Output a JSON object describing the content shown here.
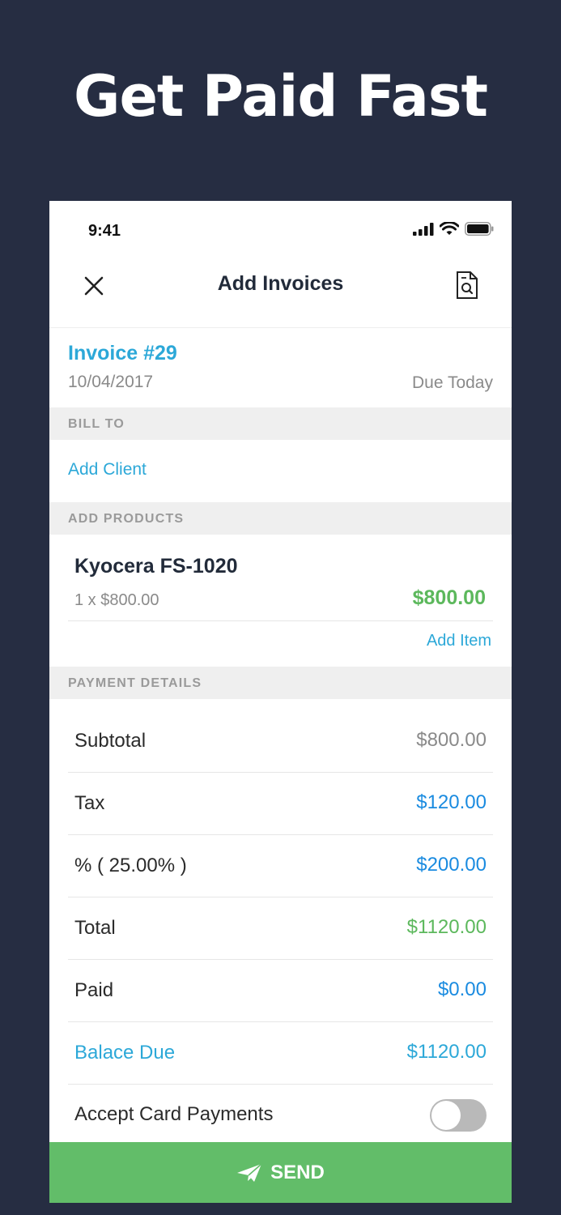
{
  "headline": "Get Paid Fast",
  "status_bar": {
    "time": "9:41"
  },
  "nav": {
    "title": "Add Invoices"
  },
  "invoice": {
    "number": "Invoice #29",
    "date": "10/04/2017",
    "due": "Due Today"
  },
  "bill_to": {
    "header": "BILL TO",
    "add_client": "Add Client"
  },
  "products": {
    "header": "ADD PRODUCTS",
    "items": [
      {
        "name": "Kyocera FS-1020",
        "qty": "1 x $800.00",
        "price": "$800.00"
      }
    ],
    "add_item": "Add Item"
  },
  "payment": {
    "header": "PAYMENT DETAILS",
    "rows": [
      {
        "label": "Subtotal",
        "value": "$800.00"
      },
      {
        "label": "Tax",
        "value": "$120.00"
      },
      {
        "label": "% ( 25.00% )",
        "value": "$200.00"
      },
      {
        "label": "Total",
        "value": "$1120.00"
      },
      {
        "label": "Paid",
        "value": "$0.00"
      },
      {
        "label": "Balace Due",
        "value": "$1120.00"
      }
    ],
    "accept_card": "Accept Card Payments",
    "accept_card_enabled": false
  },
  "send_label": "SEND",
  "colors": {
    "background": "#262d42",
    "accent_blue": "#2ca8d8",
    "value_blue": "#1a8be0",
    "green": "#5cb85c",
    "send_green": "#62bd69",
    "muted": "#8a8a8a"
  }
}
